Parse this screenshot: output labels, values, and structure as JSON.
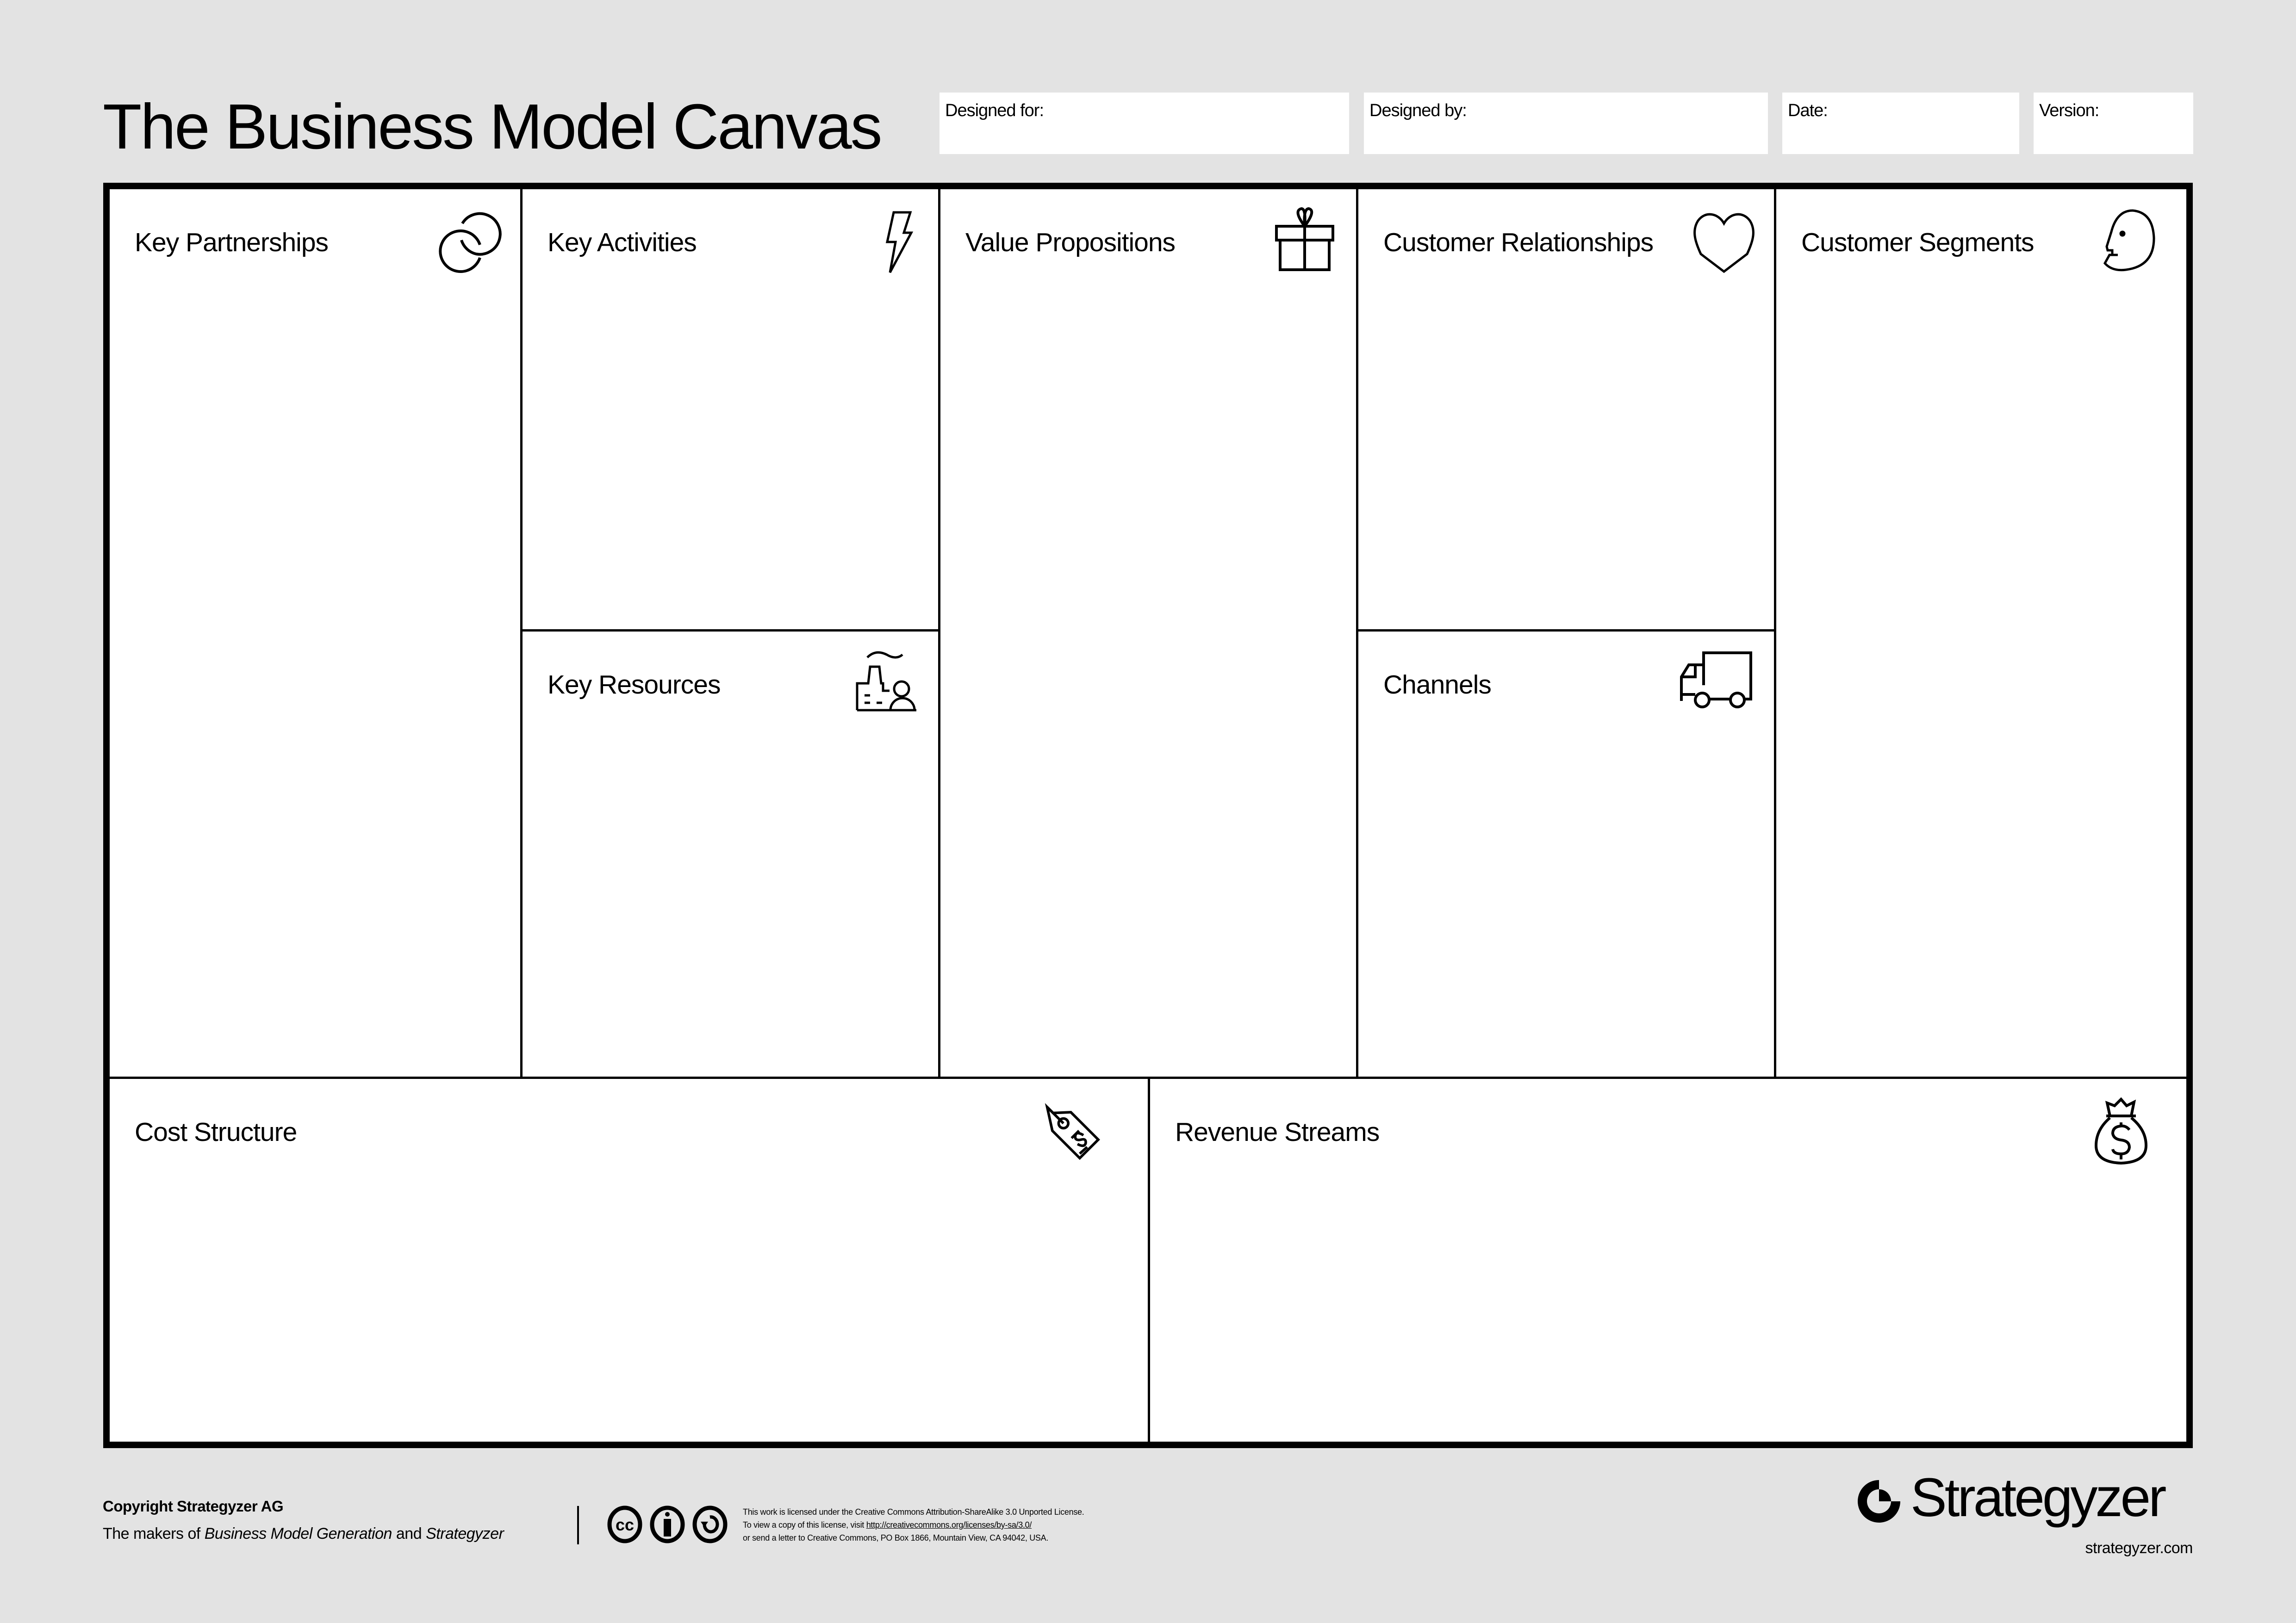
{
  "title": "The Business Model Canvas",
  "meta_fields": [
    {
      "label": "Designed for:",
      "value": ""
    },
    {
      "label": "Designed by:",
      "value": ""
    },
    {
      "label": "Date:",
      "value": ""
    },
    {
      "label": "Version:",
      "value": ""
    }
  ],
  "blocks": {
    "key_partnerships": {
      "label": "Key Partnerships",
      "icon": "link-icon"
    },
    "key_activities": {
      "label": "Key Activities",
      "icon": "lightning-icon"
    },
    "key_resources": {
      "label": "Key Resources",
      "icon": "factory-person-icon"
    },
    "value_propositions": {
      "label": "Value Propositions",
      "icon": "gift-icon"
    },
    "customer_relationships": {
      "label": "Customer Relationships",
      "icon": "heart-icon"
    },
    "channels": {
      "label": "Channels",
      "icon": "truck-icon"
    },
    "customer_segments": {
      "label": "Customer Segments",
      "icon": "face-icon"
    },
    "cost_structure": {
      "label": "Cost Structure",
      "icon": "price-tag-icon"
    },
    "revenue_streams": {
      "label": "Revenue Streams",
      "icon": "money-bag-icon"
    }
  },
  "footer": {
    "copyright": "Copyright Strategyzer AG",
    "makers_prefix": "The makers of ",
    "makers_book": "Business Model Generation",
    "makers_and": " and ",
    "makers_brand": "Strategyzer",
    "license_line1": "This work is licensed under the Creative Commons Attribution-ShareAlike 3.0 Unported License.",
    "license_line2_prefix": "To view a copy of this license, visit ",
    "license_link": "http://creativecommons.org/licenses/by-sa/3.0/",
    "license_line3": "or send a letter to Creative Commons, PO Box 1866, Mountain View, CA 94042, USA.",
    "brand_name": "Strategyzer",
    "brand_url": "strategyzer.com"
  }
}
